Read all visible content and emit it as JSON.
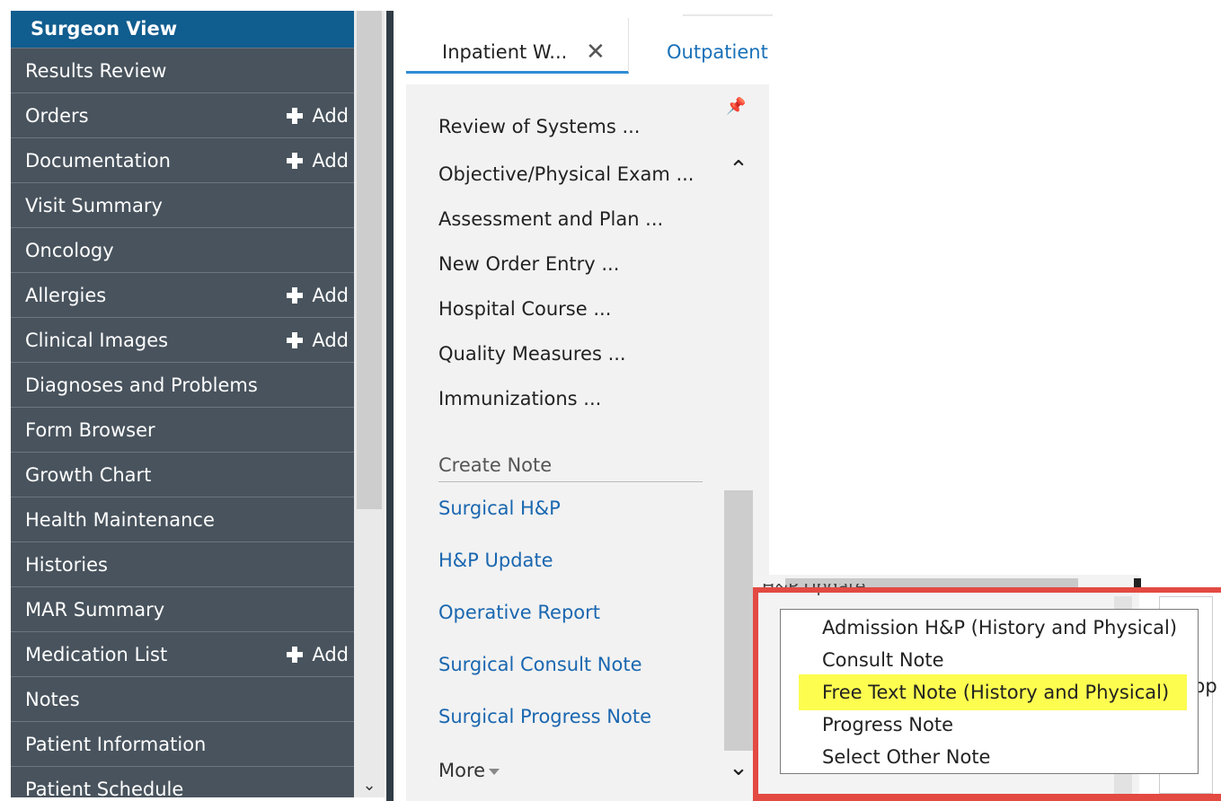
{
  "menu": {
    "title": "Surgeon View",
    "add_label": "Add",
    "items": [
      {
        "label": "Results Review",
        "add": false
      },
      {
        "label": "Orders",
        "add": true
      },
      {
        "label": "Documentation",
        "add": true
      },
      {
        "label": "Visit Summary",
        "add": false
      },
      {
        "label": "Oncology",
        "add": false
      },
      {
        "label": "Allergies",
        "add": true
      },
      {
        "label": "Clinical Images",
        "add": true
      },
      {
        "label": "Diagnoses and Problems",
        "add": false
      },
      {
        "label": "Form Browser",
        "add": false
      },
      {
        "label": "Growth Chart",
        "add": false
      },
      {
        "label": "Health Maintenance",
        "add": false
      },
      {
        "label": "Histories",
        "add": false
      },
      {
        "label": "MAR Summary",
        "add": false
      },
      {
        "label": "Medication List",
        "add": true
      },
      {
        "label": "Notes",
        "add": false
      },
      {
        "label": "Patient Information",
        "add": false
      },
      {
        "label": "Patient Schedule",
        "add": false
      }
    ]
  },
  "tabs": {
    "active": "Inpatient W...",
    "inactive": "Outpatient"
  },
  "panel": {
    "sections": [
      "Review of Systems ...",
      "Objective/Physical Exam ...",
      "Assessment and Plan ...",
      "New Order Entry ...",
      "Hospital Course ...",
      "Quality Measures ...",
      "Immunizations ..."
    ],
    "create_note_label": "Create Note",
    "notes": [
      "Surgical H&P",
      "H&P Update",
      "Operative Report",
      "Surgical Consult Note",
      "Surgical Progress Note"
    ],
    "more_label": "More"
  },
  "popup": {
    "partial_header": "H&P Update",
    "side_text": "pp",
    "options": [
      "Admission H&P (History and Physical)",
      "Consult Note",
      "Free Text Note (History and Physical)",
      "Progress Note",
      "Select Other Note"
    ],
    "highlighted_index": 2
  },
  "colors": {
    "menu_bg": "#48535d",
    "header_bg": "#105d8f",
    "link": "#1a67b0",
    "highlight": "#fdfd50",
    "annotation": "#e34a42"
  }
}
